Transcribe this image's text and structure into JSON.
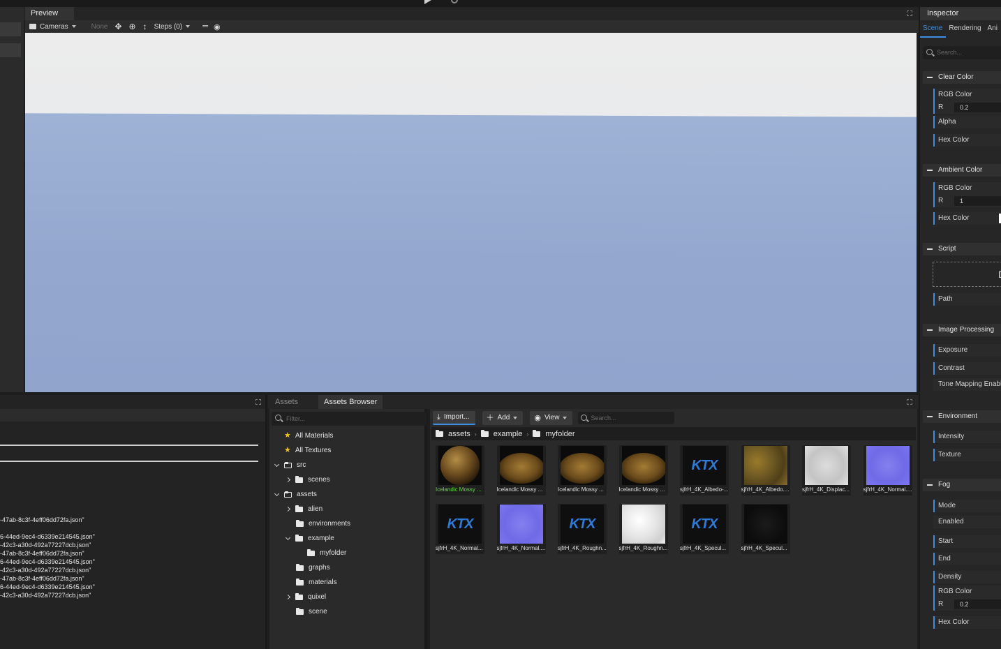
{
  "preview": {
    "title": "Preview",
    "toolbar": {
      "cameras": "Cameras",
      "none": "None",
      "steps": "Steps (0)"
    }
  },
  "inspector": {
    "title": "Inspector",
    "tabs": [
      "Scene",
      "Rendering",
      "Ani"
    ],
    "search_placeholder": "Search...",
    "sections": {
      "clear_color": {
        "title": "Clear Color",
        "rgb_color": "RGB Color",
        "r_label": "R",
        "r_value": "0.2",
        "alpha": "Alpha",
        "hex_color": "Hex Color"
      },
      "ambient_color": {
        "title": "Ambient Color",
        "rgb_color": "RGB Color",
        "r_label": "R",
        "r_value": "1",
        "hex_color": "Hex Color"
      },
      "script": {
        "title": "Script",
        "drop_text": "Dr",
        "path": "Path"
      },
      "image_processing": {
        "title": "Image Processing",
        "exposure": "Exposure",
        "contrast": "Contrast",
        "tone_mapping": "Tone Mapping Enable"
      },
      "environment": {
        "title": "Environment",
        "intensity": "Intensity",
        "texture": "Texture"
      },
      "fog": {
        "title": "Fog",
        "mode": "Mode",
        "enabled": "Enabled",
        "start": "Start",
        "end": "End",
        "density": "Density",
        "rgb_color": "RGB Color",
        "r_label": "R",
        "r_value": "0.2",
        "hex_color": "Hex Color"
      }
    }
  },
  "log": {
    "lines": [
      "-47ab-8c3f-4eff06dd72fa.json\"",
      "6-44ed-9ec4-d6339e214545.json\"",
      "-42c3-a30d-492a77227dcb.json\"",
      "-47ab-8c3f-4eff06dd72fa.json\"",
      "6-44ed-9ec4-d6339e214545.json\"",
      "-42c3-a30d-492a77227dcb.json\"",
      "-47ab-8c3f-4eff06dd72fa.json\"",
      "6-44ed-9ec4-d6339e214545.json\"",
      "-42c3-a30d-492a77227dcb.json\""
    ]
  },
  "assets_tabs": {
    "assets": "Assets",
    "browser": "Assets Browser"
  },
  "tree": {
    "filter_placeholder": "Filter...",
    "items": [
      {
        "label": "All Materials"
      },
      {
        "label": "All Textures"
      },
      {
        "label": "src"
      },
      {
        "label": "scenes"
      },
      {
        "label": "assets"
      },
      {
        "label": "alien"
      },
      {
        "label": "environments"
      },
      {
        "label": "example"
      },
      {
        "label": "myfolder"
      },
      {
        "label": "graphs"
      },
      {
        "label": "materials"
      },
      {
        "label": "quixel"
      },
      {
        "label": "scene"
      }
    ]
  },
  "browser": {
    "import": "Import...",
    "add": "Add",
    "view": "View",
    "search_placeholder": "Search...",
    "breadcrumb": [
      "assets",
      "example",
      "myfolder"
    ],
    "tiles": [
      {
        "label": "Icelandic Mossy ...",
        "kind": "sphere"
      },
      {
        "label": "Icelandic Mossy ...",
        "kind": "disc"
      },
      {
        "label": "Icelandic Mossy ...",
        "kind": "disc"
      },
      {
        "label": "Icelandic Mossy ...",
        "kind": "disc"
      },
      {
        "label": "sjfrH_4K_Albedo-...",
        "kind": "ktx"
      },
      {
        "label": "sjfrH_4K_Albedo....",
        "kind": "albedo"
      },
      {
        "label": "sjfrH_4K_Displac...",
        "kind": "disp"
      },
      {
        "label": "sjfrH_4K_Normal....",
        "kind": "normal"
      },
      {
        "label": "sjfrH_4K_Normal...",
        "kind": "ktx"
      },
      {
        "label": "sjfrH_4K_Normal....",
        "kind": "normal"
      },
      {
        "label": "sjfrH_4K_Roughn...",
        "kind": "ktx"
      },
      {
        "label": "sjfrH_4K_Roughn...",
        "kind": "rough"
      },
      {
        "label": "sjfrH_4K_Specul...",
        "kind": "ktx"
      },
      {
        "label": "sjfrH_4K_Specul...",
        "kind": "spec"
      }
    ],
    "ktx_text": "KTX"
  }
}
